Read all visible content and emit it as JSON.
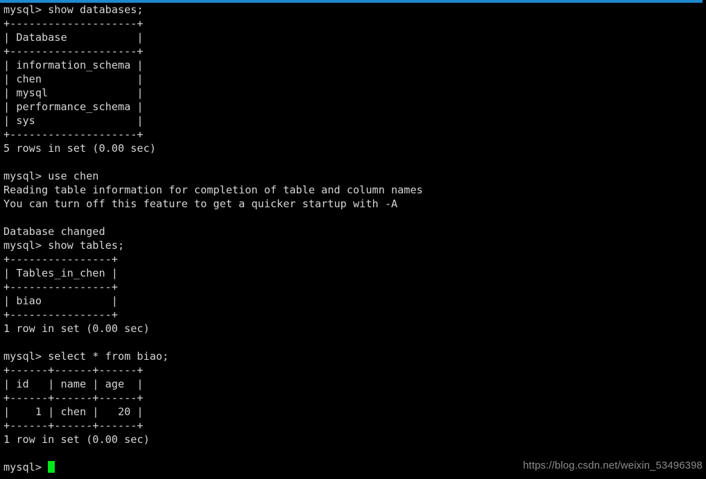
{
  "window": {
    "title_bar_accent_color": "#1e88d0",
    "background_color": "#000000",
    "foreground_color": "#d6d6d6"
  },
  "terminal": {
    "prompt": "mysql> ",
    "cursor": {
      "name": "block-cursor",
      "color": "#00e61a",
      "visible": true
    },
    "lines": [
      "mysql> show databases;",
      "+--------------------+",
      "| Database           |",
      "+--------------------+",
      "| information_schema |",
      "| chen               |",
      "| mysql              |",
      "| performance_schema |",
      "| sys                |",
      "+--------------------+",
      "5 rows in set (0.00 sec)",
      "",
      "mysql> use chen",
      "Reading table information for completion of table and column names",
      "You can turn off this feature to get a quicker startup with -A",
      "",
      "Database changed",
      "mysql> show tables;",
      "+----------------+",
      "| Tables_in_chen |",
      "+----------------+",
      "| biao           |",
      "+----------------+",
      "1 row in set (0.00 sec)",
      "",
      "mysql> select * from biao;",
      "+------+------+------+",
      "| id   | name | age  |",
      "+------+------+------+",
      "|    1 | chen |   20 |",
      "+------+------+------+",
      "1 row in set (0.00 sec)",
      ""
    ],
    "commands": [
      "show databases;",
      "use chen",
      "show tables;",
      "select * from biao;"
    ],
    "databases_result": {
      "columns": [
        "Database"
      ],
      "rows": [
        [
          "information_schema"
        ],
        [
          "chen"
        ],
        [
          "mysql"
        ],
        [
          "performance_schema"
        ],
        [
          "sys"
        ]
      ],
      "status": "5 rows in set (0.00 sec)"
    },
    "use_messages": [
      "Reading table information for completion of table and column names",
      "You can turn off this feature to get a quicker startup with -A",
      "Database changed"
    ],
    "tables_result": {
      "columns": [
        "Tables_in_chen"
      ],
      "rows": [
        [
          "biao"
        ]
      ],
      "status": "1 row in set (0.00 sec)"
    },
    "select_result": {
      "columns": [
        "id",
        "name",
        "age"
      ],
      "rows": [
        [
          "1",
          "chen",
          "20"
        ]
      ],
      "status": "1 row in set (0.00 sec)"
    }
  },
  "watermark": {
    "text": "https://blog.csdn.net/weixin_53496398",
    "color": "#8c8c8c"
  }
}
